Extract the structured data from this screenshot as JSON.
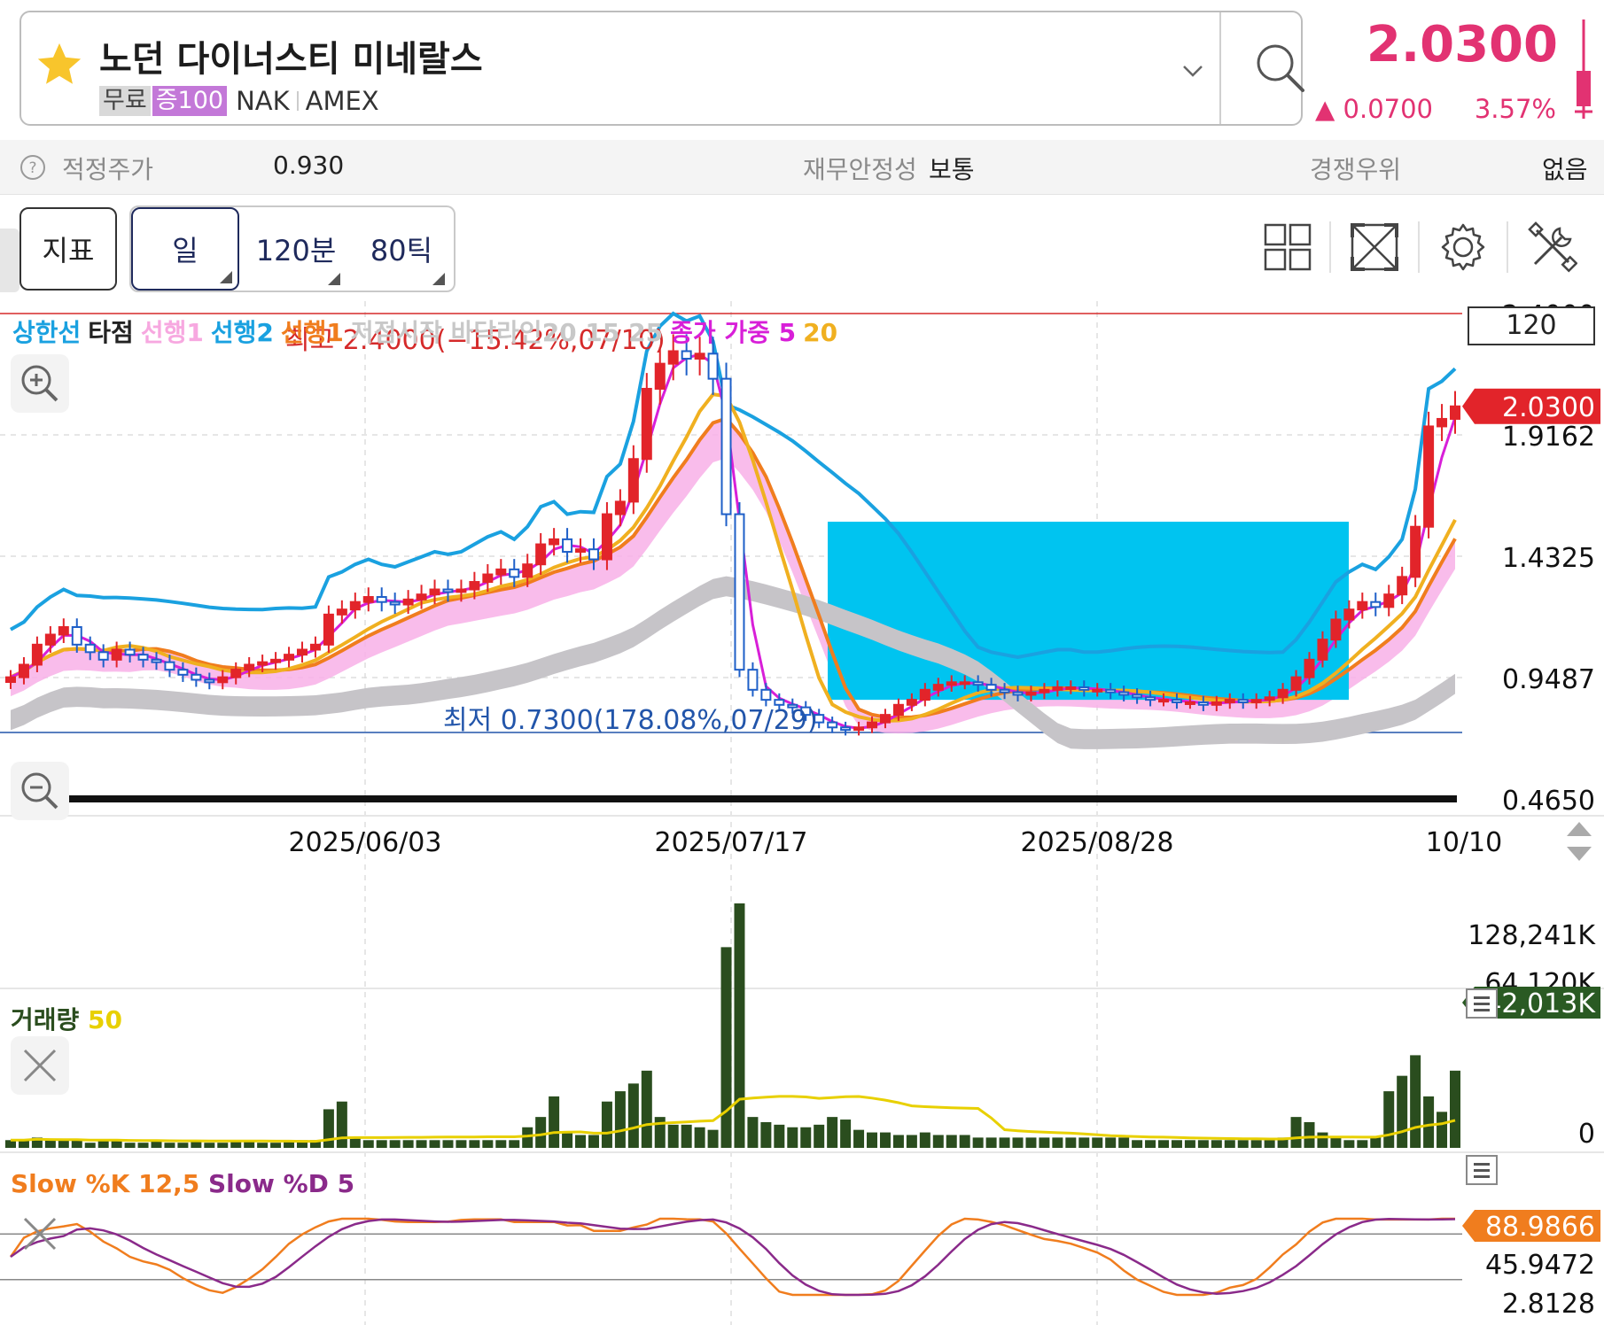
{
  "header": {
    "stock_name": "노던 다이너스티 미네랄스",
    "tag_free": "무료",
    "tag_margin": "증100",
    "ticker": "NAK",
    "exchange": "AMEX",
    "price": "2.0300",
    "change": "▲ 0.0700",
    "change_pct": "3.57%"
  },
  "info_bar": {
    "fair_price_label": "적정주가",
    "fair_price_value": "0.930",
    "stability_label": "재무안정성",
    "stability_value": "보통",
    "competitive_label": "경쟁우위",
    "competitive_value": "없음"
  },
  "toolbar": {
    "indicator": "지표",
    "period_day": "일",
    "period_120": "120분",
    "period_80": "80틱"
  },
  "chart": {
    "legend": [
      {
        "text": "상한선",
        "color": "#1aa1e0"
      },
      {
        "text": "타점",
        "color": "#222222"
      },
      {
        "text": "선행1",
        "color": "#f7a8e0"
      },
      {
        "text": "선행2",
        "color": "#1aa1e0"
      },
      {
        "text": "선행1",
        "color": "#f07d1e"
      },
      {
        "text": "저점시작 바닥라인20 15 25",
        "color": "#c8c8c8"
      },
      {
        "text": "종가 가중 5",
        "color": "#d81fd8"
      },
      {
        "text": "20",
        "color": "#f0b020"
      }
    ],
    "period_count": "120",
    "high_label": "최고 2.4000(−15.42%,07/10)",
    "low_label": "최저 0.7300(178.08%,07/29)",
    "price_axis": [
      "2.4000",
      "1.9162",
      "1.4325",
      "0.9487",
      "0.4650"
    ],
    "current_price_tag": "2.0300",
    "date_axis": [
      "2025/06/03",
      "2025/07/17",
      "2025/08/28",
      "10/10"
    ],
    "volume_legend_name": "거래량",
    "volume_legend_period": "50",
    "volume_axis": [
      "128,241K",
      "64,120K",
      "0"
    ],
    "volume_tag": "42,013K",
    "stoch_legend_k": "Slow %K 12,5",
    "stoch_legend_d": "Slow %D 5",
    "stoch_axis": [
      "45.9472",
      "2.8128"
    ],
    "stoch_tag": "88.9866"
  },
  "chart_data": {
    "type": "candlestick",
    "price_range": [
      0.465,
      2.4
    ],
    "high": 2.4,
    "low": 0.73,
    "last": 2.03,
    "x_labels": [
      "2025/06/03",
      "2025/07/17",
      "2025/08/28",
      "10/10"
    ],
    "close_series": [
      0.95,
      1.0,
      1.08,
      1.12,
      1.15,
      1.08,
      1.05,
      1.02,
      1.06,
      1.04,
      1.02,
      1.01,
      0.98,
      0.96,
      0.94,
      0.93,
      0.95,
      0.98,
      1.0,
      1.01,
      1.02,
      1.04,
      1.06,
      1.08,
      1.2,
      1.22,
      1.25,
      1.27,
      1.25,
      1.24,
      1.26,
      1.28,
      1.3,
      1.29,
      1.3,
      1.33,
      1.36,
      1.38,
      1.35,
      1.4,
      1.48,
      1.5,
      1.45,
      1.46,
      1.42,
      1.6,
      1.65,
      1.82,
      2.1,
      2.2,
      2.25,
      2.22,
      2.24,
      2.14,
      1.6,
      0.98,
      0.9,
      0.86,
      0.84,
      0.83,
      0.8,
      0.77,
      0.75,
      0.74,
      0.75,
      0.77,
      0.8,
      0.84,
      0.86,
      0.9,
      0.92,
      0.93,
      0.93,
      0.92,
      0.9,
      0.89,
      0.88,
      0.89,
      0.9,
      0.91,
      0.91,
      0.9,
      0.9,
      0.89,
      0.88,
      0.87,
      0.86,
      0.86,
      0.85,
      0.85,
      0.84,
      0.85,
      0.86,
      0.85,
      0.86,
      0.87,
      0.9,
      0.95,
      1.02,
      1.1,
      1.18,
      1.22,
      1.25,
      1.23,
      1.28,
      1.35,
      1.55,
      1.95,
      1.98,
      2.03
    ],
    "volume_series": [
      3,
      3,
      4,
      3,
      3,
      3,
      2,
      3,
      3,
      2,
      2,
      3,
      2,
      2,
      3,
      2,
      2,
      3,
      3,
      2,
      2,
      3,
      3,
      3,
      15,
      18,
      4,
      3,
      3,
      3,
      3,
      3,
      3,
      3,
      3,
      3,
      3,
      3,
      3,
      8,
      12,
      20,
      6,
      5,
      5,
      18,
      22,
      25,
      30,
      12,
      9,
      9,
      8,
      7,
      78,
      95,
      12,
      10,
      9,
      8,
      8,
      9,
      12,
      11,
      7,
      6,
      6,
      5,
      5,
      6,
      5,
      5,
      5,
      4,
      4,
      4,
      4,
      4,
      4,
      4,
      4,
      4,
      4,
      4,
      4,
      3,
      3,
      3,
      3,
      3,
      3,
      3,
      3,
      3,
      3,
      3,
      4,
      12,
      10,
      6,
      4,
      3,
      3,
      4,
      22,
      28,
      36,
      20,
      14,
      30
    ],
    "volume_range": [
      0,
      128241
    ],
    "stoch_range": [
      2.8128,
      100
    ]
  }
}
